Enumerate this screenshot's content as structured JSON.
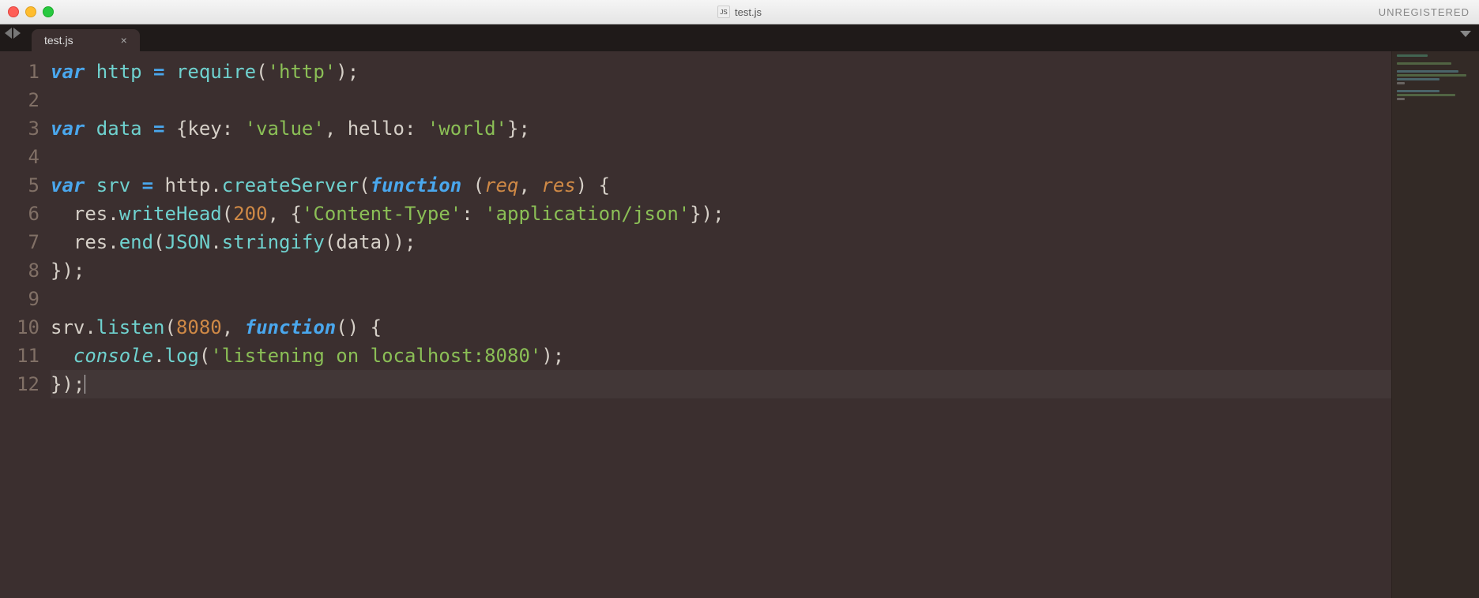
{
  "window": {
    "title": "test.js",
    "registration": "UNREGISTERED"
  },
  "tabs": [
    {
      "label": "test.js",
      "active": true
    }
  ],
  "gutter": {
    "start": 1,
    "end": 12,
    "current_line": 12
  },
  "code_lines": [
    [
      {
        "t": "var ",
        "c": "kw-st"
      },
      {
        "t": "http",
        "c": "var"
      },
      {
        "t": " ",
        "c": "punct"
      },
      {
        "t": "=",
        "c": "kw"
      },
      {
        "t": " ",
        "c": "punct"
      },
      {
        "t": "require",
        "c": "builtin"
      },
      {
        "t": "(",
        "c": "punct"
      },
      {
        "t": "'http'",
        "c": "str"
      },
      {
        "t": ");",
        "c": "punct"
      }
    ],
    [],
    [
      {
        "t": "var ",
        "c": "kw-st"
      },
      {
        "t": "data",
        "c": "var"
      },
      {
        "t": " ",
        "c": "punct"
      },
      {
        "t": "=",
        "c": "kw"
      },
      {
        "t": " {key: ",
        "c": "punct"
      },
      {
        "t": "'value'",
        "c": "str"
      },
      {
        "t": ", hello: ",
        "c": "punct"
      },
      {
        "t": "'world'",
        "c": "str"
      },
      {
        "t": "};",
        "c": "punct"
      }
    ],
    [],
    [
      {
        "t": "var ",
        "c": "kw-st"
      },
      {
        "t": "srv",
        "c": "var"
      },
      {
        "t": " ",
        "c": "punct"
      },
      {
        "t": "=",
        "c": "kw"
      },
      {
        "t": " http.",
        "c": "punct"
      },
      {
        "t": "createServer",
        "c": "var"
      },
      {
        "t": "(",
        "c": "punct"
      },
      {
        "t": "function",
        "c": "kw-st"
      },
      {
        "t": " (",
        "c": "punct"
      },
      {
        "t": "req",
        "c": "param"
      },
      {
        "t": ", ",
        "c": "punct"
      },
      {
        "t": "res",
        "c": "param"
      },
      {
        "t": ") {",
        "c": "punct"
      }
    ],
    [
      {
        "t": "  res.",
        "c": "punct"
      },
      {
        "t": "writeHead",
        "c": "var"
      },
      {
        "t": "(",
        "c": "punct"
      },
      {
        "t": "200",
        "c": "num"
      },
      {
        "t": ", {",
        "c": "punct"
      },
      {
        "t": "'Content-Type'",
        "c": "str"
      },
      {
        "t": ": ",
        "c": "punct"
      },
      {
        "t": "'application/json'",
        "c": "str"
      },
      {
        "t": "});",
        "c": "punct"
      }
    ],
    [
      {
        "t": "  res.",
        "c": "punct"
      },
      {
        "t": "end",
        "c": "var"
      },
      {
        "t": "(",
        "c": "punct"
      },
      {
        "t": "JSON",
        "c": "builtin"
      },
      {
        "t": ".",
        "c": "punct"
      },
      {
        "t": "stringify",
        "c": "var"
      },
      {
        "t": "(data));",
        "c": "punct"
      }
    ],
    [
      {
        "t": "});",
        "c": "punct"
      }
    ],
    [],
    [
      {
        "t": "srv.",
        "c": "punct"
      },
      {
        "t": "listen",
        "c": "var"
      },
      {
        "t": "(",
        "c": "punct"
      },
      {
        "t": "8080",
        "c": "num"
      },
      {
        "t": ", ",
        "c": "punct"
      },
      {
        "t": "function",
        "c": "kw-st"
      },
      {
        "t": "() {",
        "c": "punct"
      }
    ],
    [
      {
        "t": "  ",
        "c": "punct"
      },
      {
        "t": "console",
        "c": "support"
      },
      {
        "t": ".",
        "c": "punct"
      },
      {
        "t": "log",
        "c": "var"
      },
      {
        "t": "(",
        "c": "punct"
      },
      {
        "t": "'listening on localhost:8080'",
        "c": "str"
      },
      {
        "t": ");",
        "c": "punct"
      }
    ],
    [
      {
        "t": "});",
        "c": "punct"
      }
    ]
  ]
}
